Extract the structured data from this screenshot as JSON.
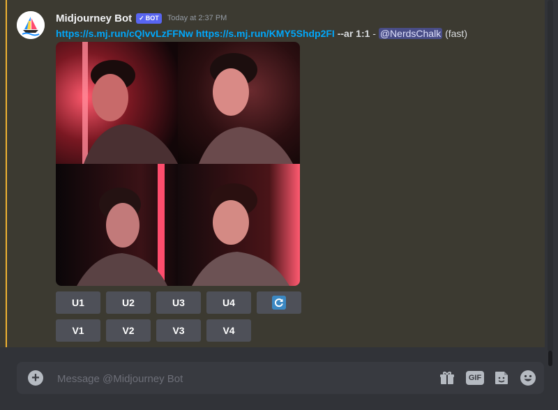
{
  "message": {
    "username": "Midjourney Bot",
    "badge_check": "✓",
    "badge": "BOT",
    "timestamp": "Today at 2:37 PM",
    "link1": "https://s.mj.run/cQlvvLzFFNw",
    "link2": "https://s.mj.run/KMY5Shdp2FI",
    "params": "--ar 1:1",
    "separator": "-",
    "mention": "@NerdsChalk",
    "mode": "(fast)"
  },
  "upscale_buttons": [
    "U1",
    "U2",
    "U3",
    "U4"
  ],
  "variation_buttons": [
    "V1",
    "V2",
    "V3",
    "V4"
  ],
  "reroll_icon": "refresh-icon",
  "composer": {
    "plus_label": "+",
    "placeholder": "Message @Midjourney Bot",
    "gif_label": "GIF"
  },
  "colors": {
    "accent": "#f0b232",
    "link": "#00a8fc",
    "badge": "#5865f2",
    "button": "#4e5058",
    "highlight_bg": "#3c3a31"
  }
}
